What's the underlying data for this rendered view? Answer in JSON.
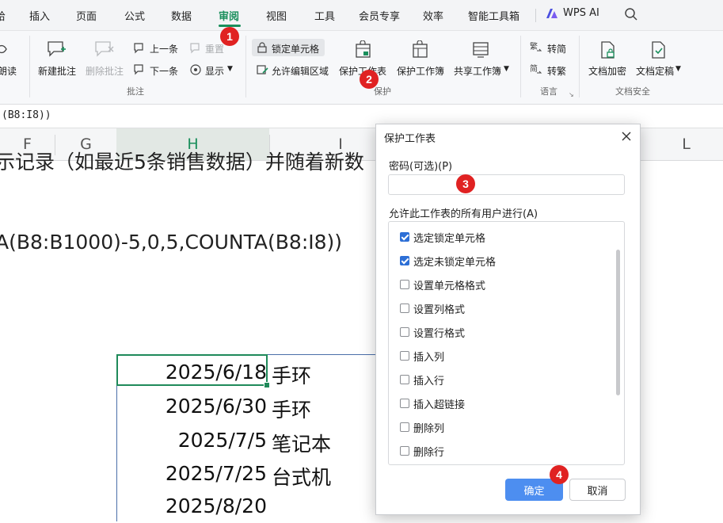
{
  "menu": {
    "items": [
      "审阅",
      "插入",
      "页面",
      "公式",
      "数据",
      "审阅",
      "视图",
      "工具",
      "会员专享",
      "效率",
      "智能工具箱"
    ],
    "partial_left": "给",
    "wps_ai": "WPS AI"
  },
  "ribbon": {
    "partial_read": "朗读",
    "new_comment": "新建批注",
    "delete_comment": "删除批注",
    "prev": "上一条",
    "next": "下一条",
    "reset": "重置",
    "show": "显示",
    "group_comments": "批注",
    "lock_cell": "锁定单元格",
    "allow_edit_range": "允许编辑区域",
    "protect_sheet": "保护工作表",
    "protect_workbook": "保护工作簿",
    "share_workbook": "共享工作簿",
    "group_protect": "保护",
    "to_simplified": "转简",
    "to_traditional": "转繁",
    "group_language": "语言",
    "doc_encrypt": "文档加密",
    "doc_finalize": "文档定稿",
    "group_security": "文档安全"
  },
  "formula_bar": {
    "text": "(B8:I8))"
  },
  "columns": [
    "F",
    "G",
    "H",
    "I",
    "L"
  ],
  "sheet": {
    "line1": "示记录（如最近5条销售数据）并随着新数",
    "line2": "A(B8:B1000)-5,0,5,COUNTA(B8:I8))",
    "rows": [
      {
        "date": "2025/6/18",
        "item": "手环"
      },
      {
        "date": "2025/6/30",
        "item": "手环"
      },
      {
        "date": "2025/7/5",
        "item": "笔记本"
      },
      {
        "date": "2025/7/25",
        "item": "台式机"
      },
      {
        "date": "2025/8/20",
        "item": ""
      }
    ]
  },
  "dialog": {
    "title": "保护工作表",
    "password_label": "密码(可选)(P)",
    "password_value": "",
    "allow_label": "允许此工作表的所有用户进行(A)",
    "permissions": [
      {
        "label": "选定锁定单元格",
        "checked": true
      },
      {
        "label": "选定未锁定单元格",
        "checked": true
      },
      {
        "label": "设置单元格格式",
        "checked": false
      },
      {
        "label": "设置列格式",
        "checked": false
      },
      {
        "label": "设置行格式",
        "checked": false
      },
      {
        "label": "插入列",
        "checked": false
      },
      {
        "label": "插入行",
        "checked": false
      },
      {
        "label": "插入超链接",
        "checked": false
      },
      {
        "label": "删除列",
        "checked": false
      },
      {
        "label": "删除行",
        "checked": false
      }
    ],
    "ok": "确定",
    "cancel": "取消"
  },
  "badges": [
    "1",
    "2",
    "3",
    "4"
  ],
  "colors": {
    "accent": "#1a8f5c",
    "badge": "#e02222",
    "primary": "#4d8ef0"
  }
}
